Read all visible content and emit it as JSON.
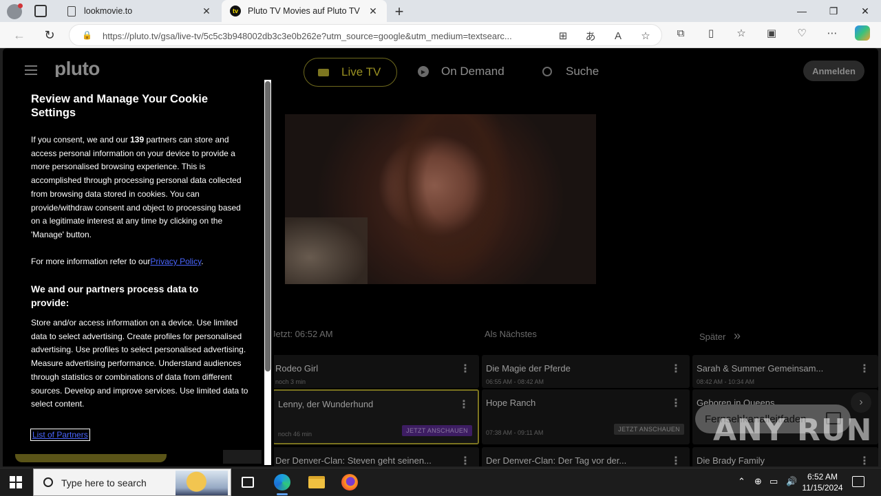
{
  "browser": {
    "tabs": [
      {
        "label": "lookmovie.to",
        "active": false
      },
      {
        "label": "Pluto TV Movies auf Pluto TV",
        "active": true
      }
    ],
    "tab_icon_text": "tv",
    "new_tab": "+",
    "url": "https://pluto.tv/gsa/live-tv/5c5c3b948002db3c3e0b262e?utm_source=google&utm_medium=textsearc...",
    "window_controls": {
      "minimize": "—",
      "maximize": "❐",
      "close": "✕"
    }
  },
  "site": {
    "logo": "pluto",
    "nav": {
      "live_tv": "Live TV",
      "on_demand": "On Demand",
      "search": "Suche"
    },
    "login": "Anmelden"
  },
  "cookie_dialog": {
    "title": "Review and Manage Your Cookie Settings",
    "consent_pre": "If you consent, we and our ",
    "partner_count": "139",
    "consent_post": " partners can store and access personal information on your device to provide a more personalised browsing experience. This is accomplished through processing personal data collected from browsing data stored in cookies. You can provide/withdraw consent and object to processing based on a legitimate interest at any time by clicking on the 'Manage' button.",
    "more_info_pre": "For more information refer to our",
    "privacy_link": "Privacy Policy",
    "more_info_post": ".",
    "purposes_title": "We and our partners process data to provide:",
    "purposes_text": "Store and/or access information on a device. Use limited data to select advertising. Create profiles for personalised advertising. Use profiles to select personalised advertising. Measure advertising performance. Understand audiences through statistics or combinations of data from different sources. Develop and improve services. Use limited data to select content.",
    "partners_link": "List of Partners"
  },
  "guide": {
    "col_now": "Jetzt: 06:52 AM",
    "col_next": "Als Nächstes",
    "col_later": "Später",
    "rows": [
      {
        "now": {
          "title": "Rodeo Girl",
          "sub": "noch 3 min"
        },
        "next": {
          "title": "Die Magie der Pferde",
          "sub": "06:55 AM - 08:42 AM"
        },
        "later": {
          "title": "Sarah & Summer Gemeinsam...",
          "sub": "08:42 AM - 10:34 AM"
        }
      },
      {
        "now": {
          "title": "Lenny, der Wunderhund",
          "sub": "noch 46 min",
          "button": "JETZT ANSCHAUEN"
        },
        "next": {
          "title": "Hope Ranch",
          "sub": "07:38 AM - 09:11 AM",
          "button": "JETZT ANSCHAUEN"
        },
        "later": {
          "title": "Geboren in Queens",
          "sub": ""
        }
      },
      {
        "now": {
          "title": "Der Denver-Clan: Steven geht seinen..."
        },
        "next": {
          "title": "Der Denver-Clan: Der Tag vor der..."
        },
        "later": {
          "title": "Die Brady Family"
        }
      }
    ],
    "fab_label": "Fernsehkanalleitfaden"
  },
  "watermark": "ANY RUN",
  "taskbar": {
    "search_placeholder": "Type here to search",
    "time": "6:52 AM",
    "date": "11/15/2024"
  }
}
